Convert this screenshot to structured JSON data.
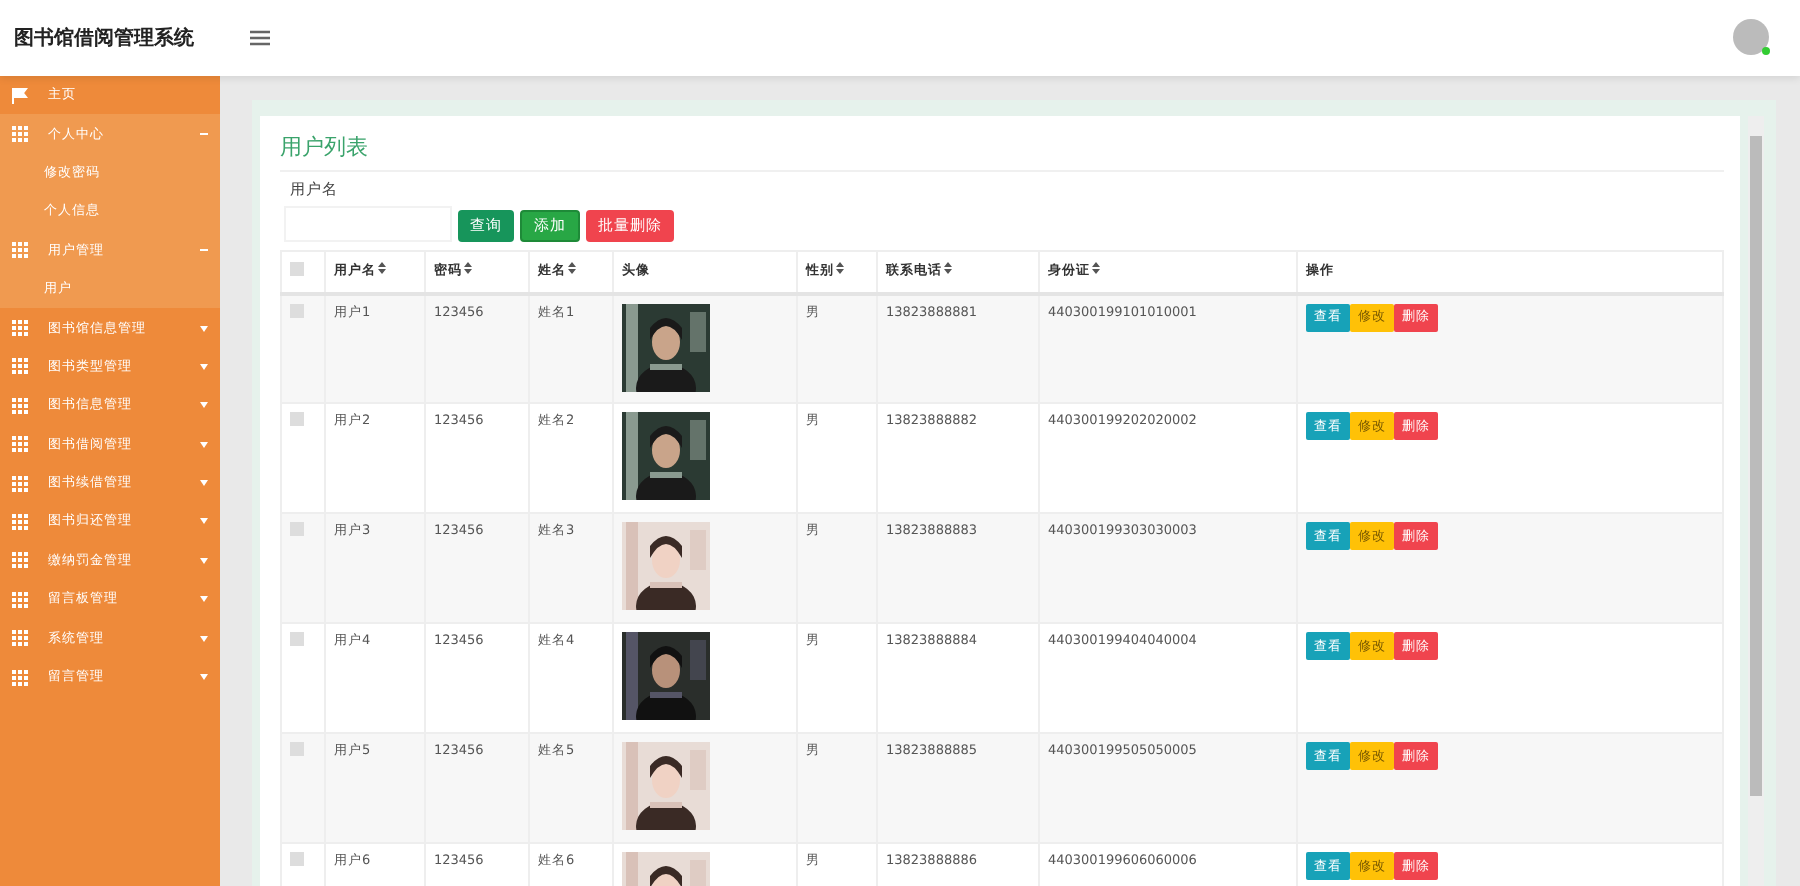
{
  "header": {
    "title": "图书馆借阅管理系统"
  },
  "sidebar": {
    "items": [
      {
        "label": "主页",
        "kind": "link"
      },
      {
        "label": "个人中心",
        "kind": "menu",
        "expanded": true,
        "children": [
          {
            "label": "修改密码"
          },
          {
            "label": "个人信息"
          }
        ]
      },
      {
        "label": "用户管理",
        "kind": "menu",
        "expanded": true,
        "children": [
          {
            "label": "用户"
          }
        ]
      },
      {
        "label": "图书馆信息管理",
        "kind": "menu",
        "expanded": false
      },
      {
        "label": "图书类型管理",
        "kind": "menu",
        "expanded": false
      },
      {
        "label": "图书信息管理",
        "kind": "menu",
        "expanded": false
      },
      {
        "label": "图书借阅管理",
        "kind": "menu",
        "expanded": false
      },
      {
        "label": "图书续借管理",
        "kind": "menu",
        "expanded": false
      },
      {
        "label": "图书归还管理",
        "kind": "menu",
        "expanded": false
      },
      {
        "label": "缴纳罚金管理",
        "kind": "menu",
        "expanded": false
      },
      {
        "label": "留言板管理",
        "kind": "menu",
        "expanded": false
      },
      {
        "label": "系统管理",
        "kind": "menu",
        "expanded": false
      },
      {
        "label": "留言管理",
        "kind": "menu",
        "expanded": false
      }
    ]
  },
  "panel": {
    "title": "用户列表",
    "search_label": "用户名",
    "buttons": [
      {
        "label": "查询",
        "kind": "search"
      },
      {
        "label": "添加",
        "kind": "add"
      },
      {
        "label": "批量删除",
        "kind": "delete"
      }
    ]
  },
  "table": {
    "select_all_checked": false,
    "columns": [
      {
        "label": "用户名",
        "sortable": true
      },
      {
        "label": "密码",
        "sortable": true
      },
      {
        "label": "姓名",
        "sortable": true
      },
      {
        "label": "头像",
        "sortable": false
      },
      {
        "label": "性别",
        "sortable": true
      },
      {
        "label": "联系电话",
        "sortable": true
      },
      {
        "label": "身份证",
        "sortable": true
      },
      {
        "label": "操作",
        "sortable": false
      }
    ],
    "rows": [
      {
        "checked": false,
        "username": "用户1",
        "password": "123456",
        "name": "姓名1",
        "gender": "男",
        "phone": "13823888881",
        "id_card": "440300199101010001",
        "actions": [
          {
            "label": "查看",
            "kind": "view"
          },
          {
            "label": "修改",
            "kind": "edit"
          },
          {
            "label": "删除",
            "kind": "delete"
          }
        ]
      },
      {
        "checked": false,
        "username": "用户2",
        "password": "123456",
        "name": "姓名2",
        "gender": "男",
        "phone": "13823888882",
        "id_card": "440300199202020002",
        "actions": [
          {
            "label": "查看",
            "kind": "view"
          },
          {
            "label": "修改",
            "kind": "edit"
          },
          {
            "label": "删除",
            "kind": "delete"
          }
        ]
      },
      {
        "checked": false,
        "username": "用户3",
        "password": "123456",
        "name": "姓名3",
        "gender": "男",
        "phone": "13823888883",
        "id_card": "440300199303030003",
        "actions": [
          {
            "label": "查看",
            "kind": "view"
          },
          {
            "label": "修改",
            "kind": "edit"
          },
          {
            "label": "删除",
            "kind": "delete"
          }
        ]
      },
      {
        "checked": false,
        "username": "用户4",
        "password": "123456",
        "name": "姓名4",
        "gender": "男",
        "phone": "13823888884",
        "id_card": "440300199404040004",
        "actions": [
          {
            "label": "查看",
            "kind": "view"
          },
          {
            "label": "修改",
            "kind": "edit"
          },
          {
            "label": "删除",
            "kind": "delete"
          }
        ]
      },
      {
        "checked": false,
        "username": "用户5",
        "password": "123456",
        "name": "姓名5",
        "gender": "男",
        "phone": "13823888885",
        "id_card": "440300199505050005",
        "actions": [
          {
            "label": "查看",
            "kind": "view"
          },
          {
            "label": "修改",
            "kind": "edit"
          },
          {
            "label": "删除",
            "kind": "delete"
          }
        ]
      },
      {
        "checked": false,
        "username": "用户6",
        "password": "123456",
        "name": "姓名6",
        "gender": "男",
        "phone": "13823888886",
        "id_card": "440300199606060006",
        "actions": [
          {
            "label": "查看",
            "kind": "view"
          },
          {
            "label": "修改",
            "kind": "edit"
          },
          {
            "label": "删除",
            "kind": "delete"
          }
        ]
      }
    ]
  }
}
